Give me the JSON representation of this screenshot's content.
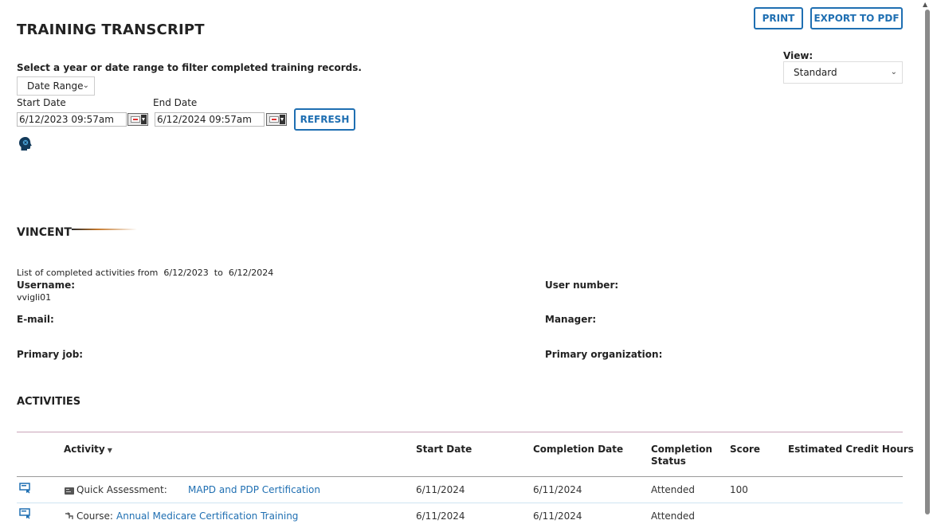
{
  "header": {
    "title": "TRAINING TRANSCRIPT",
    "print_label": "PRINT",
    "export_label": "EXPORT TO PDF"
  },
  "filter": {
    "instruction": "Select a year or date range to filter completed training records.",
    "range_select_value": "Date Range",
    "start_label": "Start Date",
    "end_label": "End Date",
    "start_value": "6/12/2023 09:57am",
    "end_value": "6/12/2024 09:57am",
    "refresh_label": "REFRESH"
  },
  "view": {
    "label": "View:",
    "value": "Standard"
  },
  "user": {
    "name": "VINCENT",
    "list_prefix": "List of completed activities from",
    "from": "6/12/2023",
    "to_word": "to",
    "to": "6/12/2024",
    "username_label": "Username:",
    "username_value": "vvigli01",
    "email_label": "E-mail:",
    "primary_job_label": "Primary job:",
    "user_number_label": "User number:",
    "manager_label": "Manager:",
    "primary_org_label": "Primary organization:"
  },
  "activities": {
    "section_title": "ACTIVITIES",
    "columns": {
      "activity": "Activity",
      "start_date": "Start Date",
      "completion_date": "Completion Date",
      "completion_status_1": "Completion",
      "completion_status_2": "Status",
      "score": "Score",
      "credit_hours": "Estimated Credit Hours"
    },
    "rows": [
      {
        "type": "Quick Assessment:",
        "title": "MAPD and PDP Certification",
        "start_date": "6/11/2024",
        "completion_date": "6/11/2024",
        "status": "Attended",
        "score": "100",
        "credit_hours": ""
      },
      {
        "type": "Course:",
        "title": "Annual Medicare Certification Training",
        "start_date": "6/11/2024",
        "completion_date": "6/11/2024",
        "status": "Attended",
        "score": "",
        "credit_hours": ""
      }
    ]
  },
  "colors": {
    "accent": "#1f6fb2",
    "table_top_border": "#c9a3b8"
  }
}
